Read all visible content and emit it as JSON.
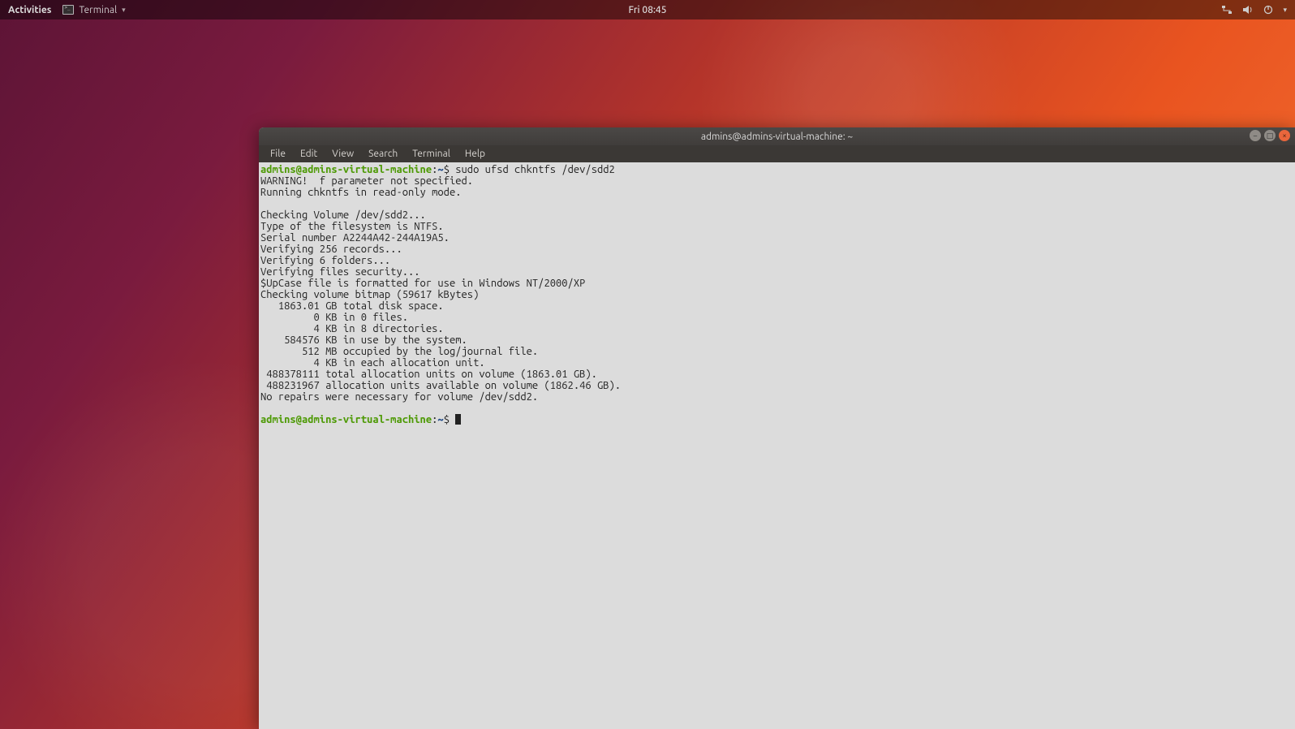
{
  "top_panel": {
    "activities": "Activities",
    "app_name": "Terminal",
    "clock": "Fri 08:45",
    "tray": {
      "network_icon": "network-wired-icon",
      "sound_icon": "sound-icon",
      "power_icon": "power-icon",
      "dropdown_icon": "dropdown-caret-icon"
    }
  },
  "window": {
    "title": "admins@admins-virtual-machine: ~",
    "controls": {
      "min": "–",
      "max": "□",
      "close": "×"
    },
    "menu": {
      "file": "File",
      "edit": "Edit",
      "view": "View",
      "search": "Search",
      "terminal": "Terminal",
      "help": "Help"
    }
  },
  "terminal": {
    "prompt_user": "admins@admins-virtual-machine",
    "prompt_sep": ":",
    "prompt_path": "~",
    "prompt_end": "$ ",
    "command": "sudo ufsd chkntfs /dev/sdd2",
    "lines": [
      "WARNING!  f parameter not specified.",
      "Running chkntfs in read-only mode.",
      "",
      "Checking Volume /dev/sdd2...",
      "Type of the filesystem is NTFS.",
      "Serial number A2244A42-244A19A5.",
      "Verifying 256 records...",
      "Verifying 6 folders...",
      "Verifying files security...",
      "$UpCase file is formatted for use in Windows NT/2000/XP",
      "Checking volume bitmap (59617 kBytes)",
      "   1863.01 GB total disk space.",
      "         0 KB in 0 files.",
      "         4 KB in 8 directories.",
      "    584576 KB in use by the system.",
      "       512 MB occupied by the log/journal file.",
      "         4 KB in each allocation unit.",
      " 488378111 total allocation units on volume (1863.01 GB).",
      " 488231967 allocation units available on volume (1862.46 GB).",
      "No repairs were necessary for volume /dev/sdd2."
    ]
  }
}
